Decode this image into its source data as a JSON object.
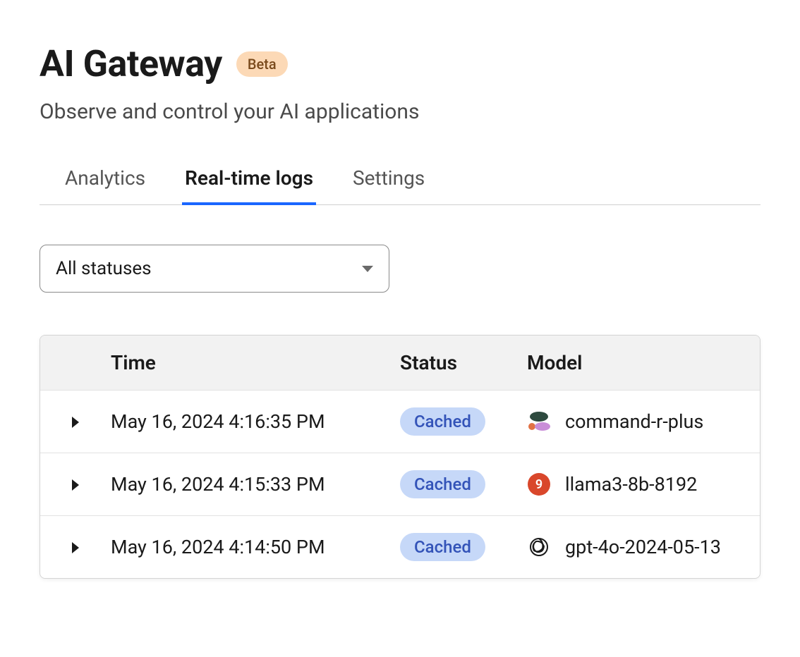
{
  "header": {
    "title": "AI Gateway",
    "badge": "Beta",
    "subtitle": "Observe and control your AI applications"
  },
  "tabs": [
    {
      "label": "Analytics",
      "active": false
    },
    {
      "label": "Real-time logs",
      "active": true
    },
    {
      "label": "Settings",
      "active": false
    }
  ],
  "filter": {
    "selected": "All statuses"
  },
  "table": {
    "columns": [
      "Time",
      "Status",
      "Model"
    ],
    "rows": [
      {
        "time": "May 16, 2024 4:16:35 PM",
        "status": "Cached",
        "model_icon": "cohere",
        "model": "command-r-plus"
      },
      {
        "time": "May 16, 2024 4:15:33 PM",
        "status": "Cached",
        "model_icon": "groq",
        "model": "llama3-8b-8192"
      },
      {
        "time": "May 16, 2024 4:14:50 PM",
        "status": "Cached",
        "model_icon": "openai",
        "model": "gpt-4o-2024-05-13"
      }
    ]
  },
  "colors": {
    "accent": "#1a66ff",
    "badge_bg": "#fcd9b6",
    "status_bg": "#c6d8f8"
  }
}
